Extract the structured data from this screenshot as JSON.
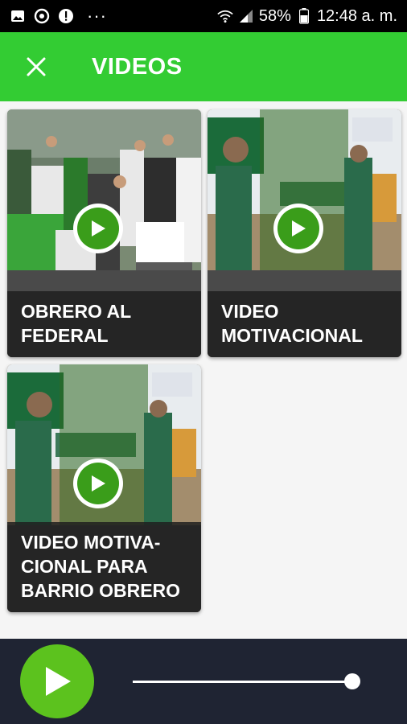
{
  "status_bar": {
    "battery": "58%",
    "time": "12:48 a. m.",
    "more_glyph": "···",
    "icons": [
      "image-icon",
      "sync-icon",
      "alert-icon",
      "wifi-icon",
      "signal-icon",
      "battery-icon"
    ]
  },
  "app_bar": {
    "title": "VIDEOS",
    "close_icon": "close-icon"
  },
  "videos": [
    {
      "title": "OBRERO AL\nFEDERAL"
    },
    {
      "title": "VIDEO\nMOTIVACIONAL"
    },
    {
      "title": "VIDEO MOTIVA-\nCIONAL PARA\nBARRIO OBRERO"
    }
  ],
  "player": {
    "play_icon": "play-icon",
    "progress": 0.96
  },
  "colors": {
    "accent_green": "#33cc33",
    "play_green": "#5cc21e",
    "player_bg": "#1f2433"
  }
}
